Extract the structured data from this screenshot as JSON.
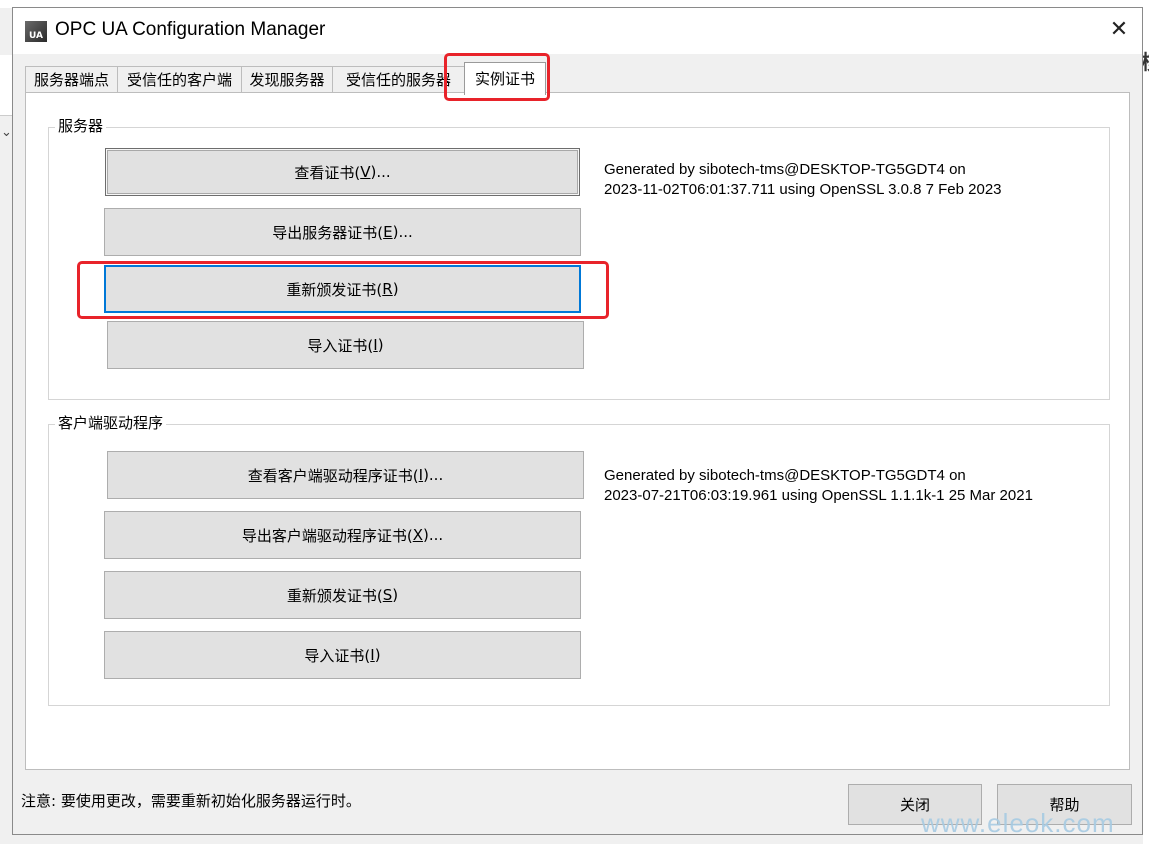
{
  "window": {
    "title": "OPC UA Configuration Manager",
    "icon_label": "UA",
    "close_glyph": "✕"
  },
  "background": {
    "left_chevron": "⌄",
    "right_char": "核"
  },
  "tabs": [
    {
      "label": "服务器端点",
      "active": false
    },
    {
      "label": "受信任的客户端",
      "active": false
    },
    {
      "label": "发现服务器",
      "active": false
    },
    {
      "label": "受信任的服务器",
      "active": false
    },
    {
      "label": "实例证书",
      "active": true
    }
  ],
  "server_group": {
    "label": "服务器",
    "buttons": {
      "view_pre": "查看证书(",
      "view_key": "V",
      "view_post": ")...",
      "export_pre": "导出服务器证书(",
      "export_key": "E",
      "export_post": ")...",
      "reissue_pre": "重新颁发证书(",
      "reissue_key": "R",
      "reissue_post": ")",
      "import_pre": "导入证书(",
      "import_key": "I",
      "import_post": ")"
    },
    "info_line1": "Generated by sibotech-tms@DESKTOP-TG5GDT4 on",
    "info_line2": "2023-11-02T06:01:37.711 using OpenSSL 3.0.8 7 Feb 2023"
  },
  "client_group": {
    "label": "客户端驱动程序",
    "buttons": {
      "view_pre": "查看客户端驱动程序证书(",
      "view_key": "I",
      "view_post": ")...",
      "export_pre": "导出客户端驱动程序证书(",
      "export_key": "X",
      "export_post": ")...",
      "reissue_pre": "重新颁发证书(",
      "reissue_key": "S",
      "reissue_post": ")",
      "import_pre": "导入证书(",
      "import_key": "I",
      "import_post": ")"
    },
    "info_line1": "Generated by sibotech-tms@DESKTOP-TG5GDT4 on",
    "info_line2": "2023-07-21T06:03:19.961 using OpenSSL 1.1.1k-1  25 Mar 2021"
  },
  "footer": {
    "note": "注意: 要使用更改，需要重新初始化服务器运行时。",
    "close_label": "关闭",
    "help_label": "帮助"
  },
  "watermark": "www.eleok.com",
  "colors": {
    "highlight_red": "#e8232a",
    "focus_blue": "#0078d7",
    "button_face": "#e1e1e1",
    "dialog_bg": "#f0f0f0"
  }
}
